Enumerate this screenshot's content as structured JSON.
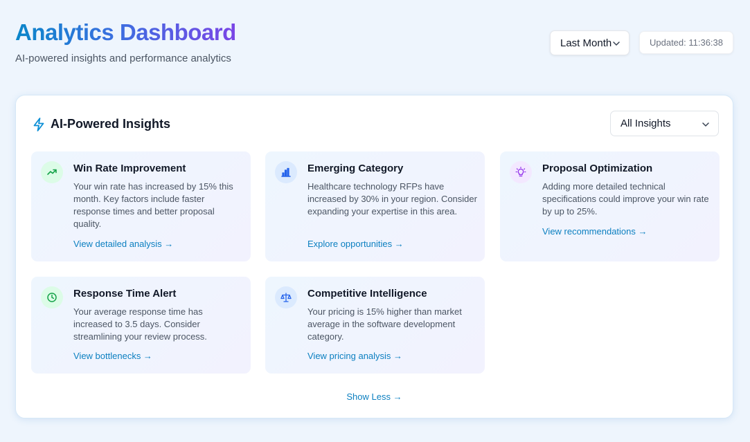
{
  "header": {
    "title": "Analytics Dashboard",
    "subtitle": "AI-powered insights and performance analytics",
    "period_select": "Last Month",
    "updated": "Updated: 11:36:38"
  },
  "insights_panel": {
    "title": "AI-Powered Insights",
    "filter_select": "All Insights",
    "show_less": "Show Less →",
    "cards": [
      {
        "icon": "trending-up-icon",
        "title": "Win Rate Improvement",
        "body": "Your win rate has increased by 15% this month. Key factors include faster response times and better proposal quality.",
        "link": "View detailed analysis →",
        "icon_bg": "#dcfce7",
        "icon_color": "#16a34a"
      },
      {
        "icon": "bar-chart-icon",
        "title": "Emerging Category",
        "body": "Healthcare technology RFPs have increased by 30% in your region. Consider expanding your expertise in this area.",
        "link": "Explore opportunities →",
        "icon_bg": "#dbeafe",
        "icon_color": "#2563eb"
      },
      {
        "icon": "lightbulb-icon",
        "title": "Proposal Optimization",
        "body": "Adding more detailed technical specifications could improve your win rate by up to 25%.",
        "link": "View recommendations →",
        "icon_bg": "#f3e8ff",
        "icon_color": "#9333ea"
      },
      {
        "icon": "clock-icon",
        "title": "Response Time Alert",
        "body": "Your average response time has increased to 3.5 days. Consider streamlining your review process.",
        "link": "View bottlenecks →",
        "icon_bg": "#dcfce7",
        "icon_color": "#16a34a"
      },
      {
        "icon": "scale-icon",
        "title": "Competitive Intelligence",
        "body": "Your pricing is 15% higher than market average in the software development category.",
        "link": "View pricing analysis →",
        "icon_bg": "#dbeafe",
        "icon_color": "#2563eb"
      }
    ]
  },
  "colors": {
    "background": "#eef5fd",
    "accent_link": "#0b7fc0",
    "title_gradient_start": "#0a86c9",
    "title_gradient_end": "#7a45e6"
  }
}
